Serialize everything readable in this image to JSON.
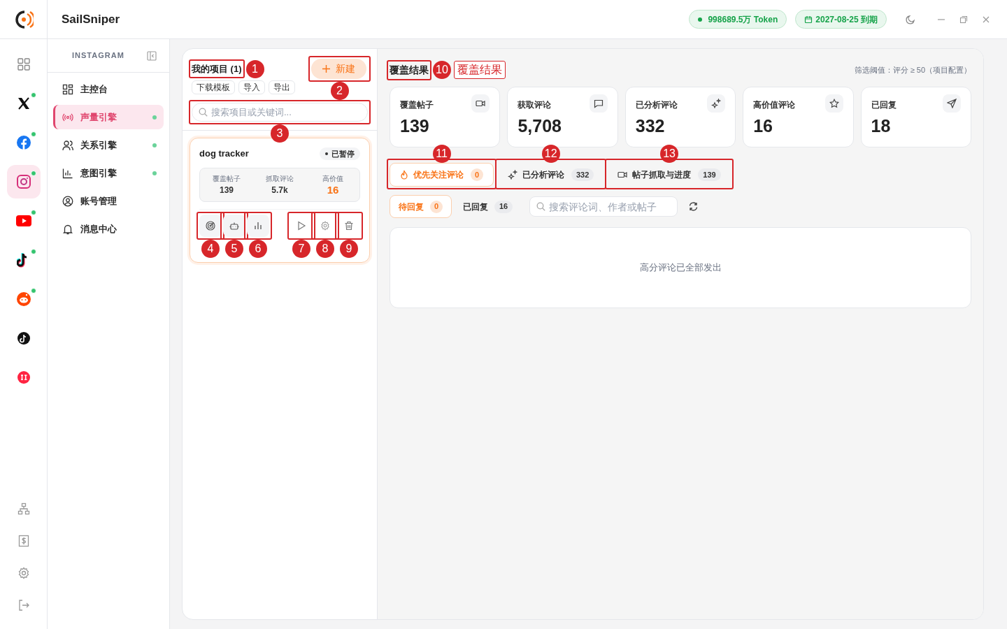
{
  "app": {
    "name": "SailSniper"
  },
  "header": {
    "token": "998689.5万 Token",
    "expiry": "2027-08-25 到期"
  },
  "rail": {
    "platforms": [
      {
        "kind": "grid",
        "selected": false,
        "online": false
      },
      {
        "kind": "x",
        "selected": false,
        "online": true
      },
      {
        "kind": "facebook",
        "selected": false,
        "online": true
      },
      {
        "kind": "instagram",
        "selected": true,
        "online": true
      },
      {
        "kind": "youtube",
        "selected": false,
        "online": true
      },
      {
        "kind": "tiktok",
        "selected": false,
        "online": true
      },
      {
        "kind": "reddit",
        "selected": false,
        "online": true
      },
      {
        "kind": "tiktok_dark",
        "selected": false,
        "online": false
      },
      {
        "kind": "rednote",
        "selected": false,
        "online": false
      }
    ],
    "tools": [
      {
        "kind": "sitemap"
      },
      {
        "kind": "billing"
      },
      {
        "kind": "settings"
      },
      {
        "kind": "logout"
      }
    ]
  },
  "sidebar": {
    "title": "INSTAGRAM",
    "items": [
      {
        "kind": "dashboard",
        "label": "主控台",
        "selected": false,
        "online": false
      },
      {
        "kind": "broadcast",
        "label": "声量引擎",
        "selected": true,
        "online": true
      },
      {
        "kind": "users",
        "label": "关系引擎",
        "selected": false,
        "online": true
      },
      {
        "kind": "chart",
        "label": "意图引擎",
        "selected": false,
        "online": true
      },
      {
        "kind": "account",
        "label": "账号管理",
        "selected": false,
        "online": false
      },
      {
        "kind": "bell",
        "label": "消息中心",
        "selected": false,
        "online": false
      }
    ]
  },
  "projects": {
    "title": "我的项目 (1)",
    "new_button": "新建",
    "actions": [
      "下载模板",
      "导入",
      "导出"
    ],
    "search_placeholder": "搜索项目或关键词...",
    "items": [
      {
        "name": "dog tracker",
        "status": "已暂停",
        "stats": [
          {
            "label": "覆盖帖子",
            "value": "139",
            "highlight": false
          },
          {
            "label": "抓取评论",
            "value": "5.7k",
            "highlight": false
          },
          {
            "label": "高价值",
            "value": "16",
            "highlight": true
          }
        ],
        "tools": [
          {
            "kind": "radar"
          },
          {
            "kind": "robot"
          },
          {
            "kind": "chart"
          },
          {
            "kind": "play"
          },
          {
            "kind": "settings"
          },
          {
            "kind": "trash"
          }
        ]
      }
    ]
  },
  "results": {
    "title": "覆盖结果",
    "threshold": "筛选阈值：评分 ≥ 50（项目配置）",
    "stats": [
      {
        "kind": "video",
        "label": "覆盖帖子",
        "value": "139"
      },
      {
        "kind": "comment",
        "label": "获取评论",
        "value": "5,708"
      },
      {
        "kind": "sparkle",
        "label": "已分析评论",
        "value": "332"
      },
      {
        "kind": "star",
        "label": "高价值评论",
        "value": "16"
      },
      {
        "kind": "send",
        "label": "已回复",
        "value": "18"
      }
    ],
    "tabs": [
      {
        "kind": "fire",
        "label": "优先关注评论",
        "count": "0",
        "selected": true
      },
      {
        "kind": "sparkle",
        "label": "已分析评论",
        "count": "332",
        "selected": false
      },
      {
        "kind": "video",
        "label": "帖子抓取与进度",
        "count": "139",
        "selected": false
      }
    ],
    "filters": [
      {
        "label": "待回复",
        "count": "0",
        "selected": true
      },
      {
        "label": "已回复",
        "count": "16",
        "selected": false
      }
    ],
    "search_placeholder": "搜索评论词、作者或帖子",
    "empty_message": "高分评论已全部发出"
  },
  "annotations": [
    {
      "number": "1"
    },
    {
      "number": "2"
    },
    {
      "number": "3"
    },
    {
      "number": "4"
    },
    {
      "number": "5"
    },
    {
      "number": "6"
    },
    {
      "number": "7"
    },
    {
      "number": "8"
    },
    {
      "number": "9"
    },
    {
      "number": "10",
      "label": "覆盖结果"
    },
    {
      "number": "11"
    },
    {
      "number": "12"
    },
    {
      "number": "13"
    }
  ]
}
